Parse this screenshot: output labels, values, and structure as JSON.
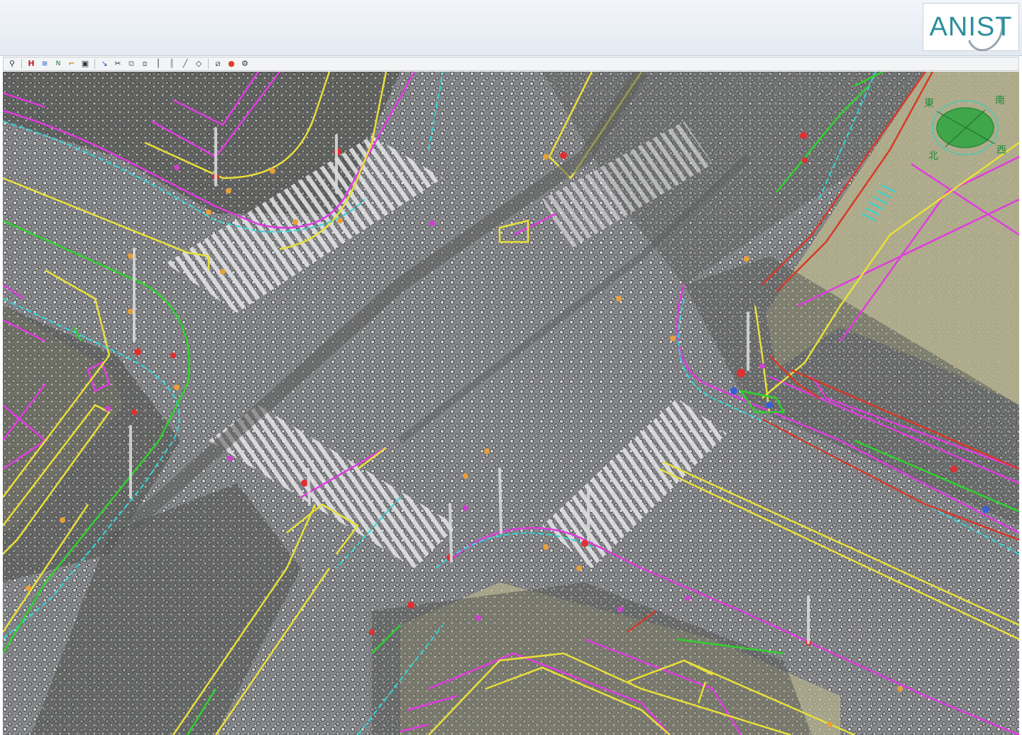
{
  "logo": {
    "text": "ANIST"
  },
  "compass": {
    "east": "東",
    "south": "南",
    "north": "北",
    "west": "西"
  },
  "toolbar": {
    "icons": [
      "person-icon",
      "h-zoom-icon",
      "layers-icon",
      "nyh-icon",
      "bracket-icon",
      "save-icon",
      "line-tool-icon",
      "scissors-icon",
      "copy-icon",
      "paste-icon",
      "split-icon",
      "parallel-icon",
      "pen-icon",
      "diamond-icon",
      "edit-frame-icon",
      "pin-icon",
      "settings-icon"
    ],
    "person": "⚲",
    "h": "H",
    "layers": "≋",
    "nyh": "N",
    "bracket": "⌐",
    "save": "▣",
    "line": "↘",
    "scissors": "✂",
    "copy": "⧉",
    "paste": "⧈",
    "split": "┃",
    "parallel": "║",
    "pen": "╱",
    "diamond": "◇",
    "frame": "⧄",
    "pin": "●",
    "settings": "⚙"
  },
  "colors": {
    "road": "#8e9093",
    "ground": "#b3b08c",
    "magenta": "#e03ce0",
    "yellow": "#e8e03a",
    "green": "#2ed12e",
    "cyan": "#2fd6d9",
    "red": "#d63a2a",
    "orange": "#e8a03a",
    "compass_fill": "#3fa64a",
    "compass_ring": "#5fc3a8"
  }
}
